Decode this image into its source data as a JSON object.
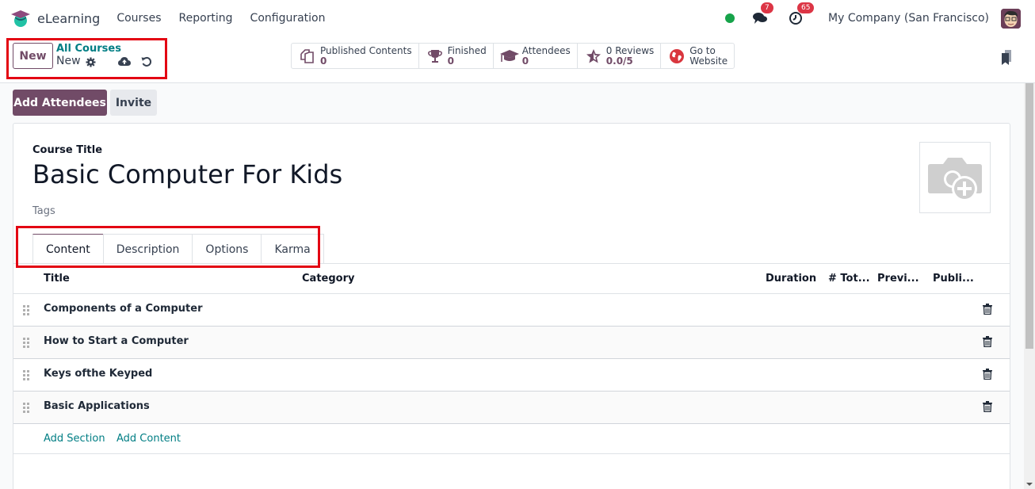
{
  "navbar": {
    "app_name": "eLearning",
    "menu": [
      "Courses",
      "Reporting",
      "Configuration"
    ],
    "messages_count": "7",
    "activities_count": "65",
    "company": "My Company (San Francisco)",
    "colors": {
      "status_online": "#16a34a",
      "badge": "#dc3545"
    }
  },
  "control_panel": {
    "new_button": "New",
    "breadcrumb_parent": "All Courses",
    "breadcrumb_current": "New",
    "stats": [
      {
        "icon": "documents-icon",
        "label": "Published Contents",
        "value": "0"
      },
      {
        "icon": "trophy-icon",
        "label": "Finished",
        "value": "0"
      },
      {
        "icon": "graduation-cap-icon",
        "label": "Attendees",
        "value": "0"
      },
      {
        "icon": "star-icon",
        "label": "0 Reviews",
        "value": "0.0/5"
      },
      {
        "icon": "globe-icon",
        "label": "Go to",
        "value": "Website"
      }
    ]
  },
  "actions": {
    "add_attendees": "Add Attendees",
    "invite": "Invite"
  },
  "form": {
    "title_label": "Course Title",
    "title_value": "Basic Computer For Kids",
    "tags_placeholder": "Tags",
    "tabs": [
      "Content",
      "Description",
      "Options",
      "Karma"
    ],
    "active_tab": "Content",
    "table": {
      "columns": [
        "Title",
        "Category",
        "Duration",
        "# Tot...",
        "Previ...",
        "Publi..."
      ],
      "rows": [
        {
          "title": "Components of a Computer"
        },
        {
          "title": "How to Start a Computer"
        },
        {
          "title": "Keys ofthe Keyped"
        },
        {
          "title": "Basic Applications"
        }
      ],
      "add_section": "Add Section",
      "add_content": "Add Content"
    }
  },
  "theme": {
    "primary": "#714b67",
    "link": "#017e84",
    "highlight": "#e30613"
  }
}
